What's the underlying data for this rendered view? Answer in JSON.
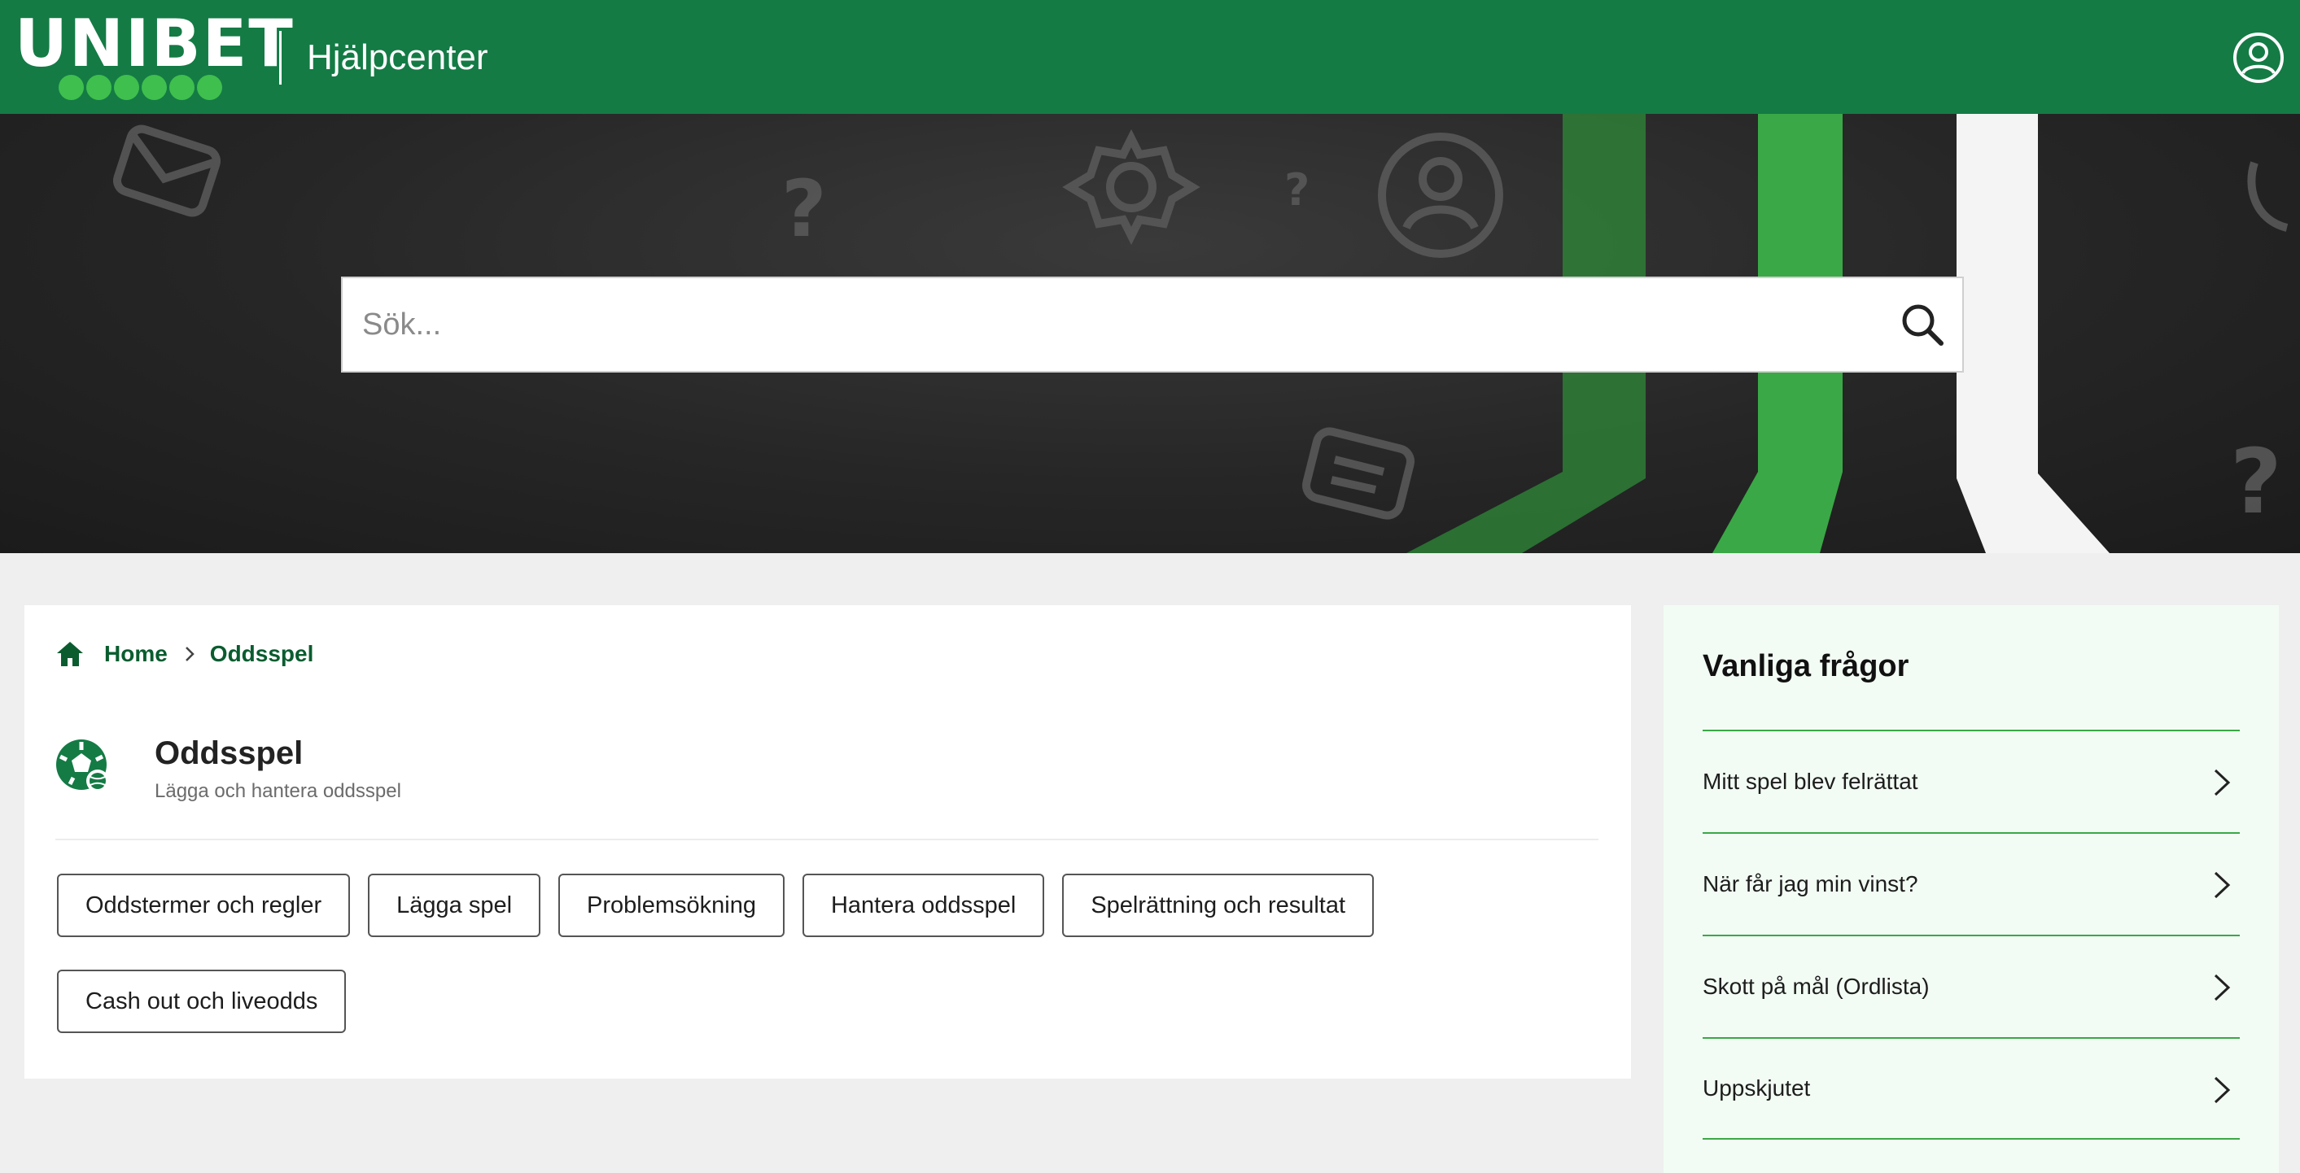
{
  "header": {
    "brand": "UNIBET",
    "title": "Hjälpcenter",
    "account_icon": "account-icon"
  },
  "colors": {
    "brand_green": "#147b45",
    "logo_dot_green": "#3fbf4d",
    "link_green": "#0a5c2f",
    "faq_background": "#f2fcf4",
    "faq_divider": "#3aa846"
  },
  "search": {
    "placeholder": "Sök...",
    "value": "",
    "icon": "search-icon"
  },
  "breadcrumb": {
    "home_icon": "home-icon",
    "items": [
      "Home",
      "Oddsspel"
    ]
  },
  "category": {
    "icon": "sports-ball-icon",
    "title": "Oddsspel",
    "subtitle": "Lägga och hantera oddsspel",
    "topics": [
      "Oddstermer och regler",
      "Lägga spel",
      "Problemsökning",
      "Hantera oddsspel",
      "Spelrättning och resultat",
      "Cash out och liveodds"
    ]
  },
  "faq": {
    "title": "Vanliga frågor",
    "items": [
      "Mitt spel blev felrättat",
      "När får jag min vinst?",
      "Skott på mål (Ordlista)",
      "Uppskjutet"
    ]
  }
}
